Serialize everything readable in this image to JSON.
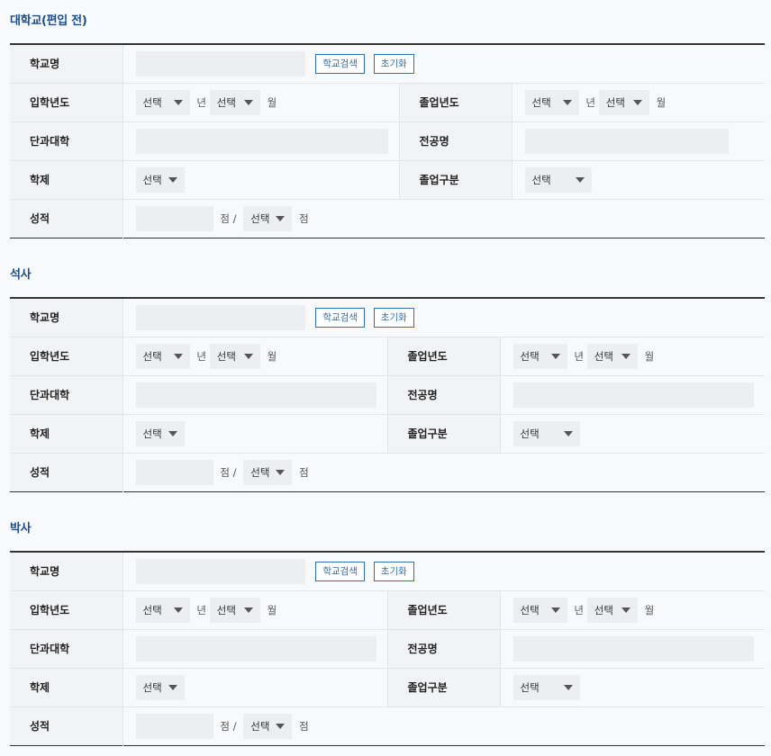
{
  "common": {
    "label_school": "학교명",
    "label_entry": "입학년도",
    "label_grad": "졸업년도",
    "label_college": "단과대학",
    "label_major": "전공명",
    "label_system": "학제",
    "label_gradtype": "졸업구분",
    "label_grade": "성적",
    "btn_search": "학교검색",
    "btn_reset": "초기화",
    "select_default": "선택",
    "unit_year": "년",
    "unit_month": "월",
    "unit_point_slash": "점 /",
    "unit_point": "점"
  },
  "sections": [
    {
      "title": "대학교(편입 전)"
    },
    {
      "title": "석사"
    },
    {
      "title": "박사"
    }
  ]
}
